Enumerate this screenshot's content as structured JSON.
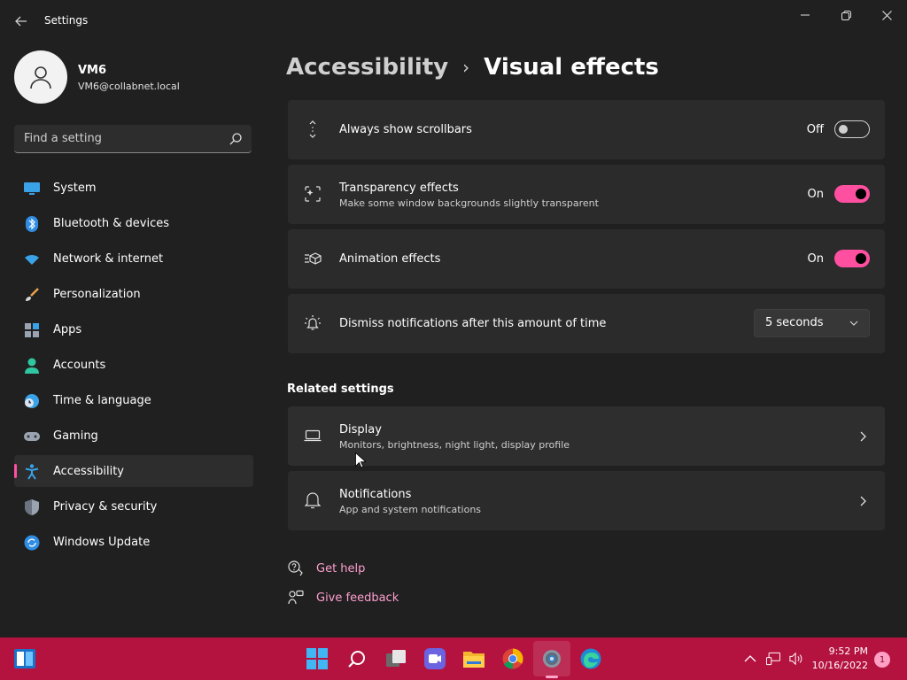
{
  "window": {
    "title": "Settings"
  },
  "profile": {
    "name": "VM6",
    "email": "VM6@collabnet.local"
  },
  "search": {
    "placeholder": "Find a setting"
  },
  "nav": {
    "items": [
      {
        "label": "System",
        "icon": "monitor-icon"
      },
      {
        "label": "Bluetooth & devices",
        "icon": "bluetooth-icon"
      },
      {
        "label": "Network & internet",
        "icon": "wifi-icon"
      },
      {
        "label": "Personalization",
        "icon": "brush-icon"
      },
      {
        "label": "Apps",
        "icon": "apps-icon"
      },
      {
        "label": "Accounts",
        "icon": "person-icon"
      },
      {
        "label": "Time & language",
        "icon": "clock-globe-icon"
      },
      {
        "label": "Gaming",
        "icon": "gamepad-icon"
      },
      {
        "label": "Accessibility",
        "icon": "accessibility-icon"
      },
      {
        "label": "Privacy & security",
        "icon": "shield-icon"
      },
      {
        "label": "Windows Update",
        "icon": "update-icon"
      }
    ],
    "active_index": 8
  },
  "breadcrumb": {
    "parent": "Accessibility",
    "separator": "›",
    "current": "Visual effects"
  },
  "settings": {
    "scrollbars": {
      "title": "Always show scrollbars",
      "state_text": "Off",
      "on": false
    },
    "transparency": {
      "title": "Transparency effects",
      "subtitle": "Make some window backgrounds slightly transparent",
      "state_text": "On",
      "on": true
    },
    "animation": {
      "title": "Animation effects",
      "state_text": "On",
      "on": true
    },
    "dismiss": {
      "title": "Dismiss notifications after this amount of time",
      "value": "5 seconds"
    }
  },
  "related": {
    "header": "Related settings",
    "display": {
      "title": "Display",
      "subtitle": "Monitors, brightness, night light, display profile"
    },
    "notifications": {
      "title": "Notifications",
      "subtitle": "App and system notifications"
    }
  },
  "help": {
    "get_help": "Get help",
    "give_feedback": "Give feedback"
  },
  "taskbar": {
    "time": "9:52 PM",
    "date": "10/16/2022",
    "notification_count": "1"
  },
  "colors": {
    "accent": "#ff4fa0",
    "taskbar": "#b4123f",
    "link": "#ff9fd0"
  }
}
